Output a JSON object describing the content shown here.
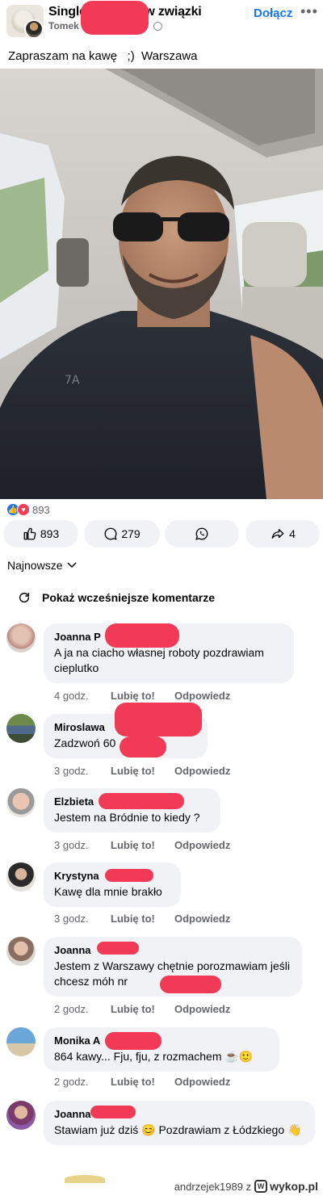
{
  "header": {
    "group_title": "Single łączy się w związki",
    "author": "Tomek",
    "join_label": "Dołącz",
    "more_label": "•••"
  },
  "post": {
    "text": "Zapraszam na kawę   ;)  Warszawa"
  },
  "reactions": {
    "count": "893"
  },
  "actions": {
    "like_count": "893",
    "comment_count": "279",
    "share_count": "4"
  },
  "sort": {
    "label": "Najnowsze"
  },
  "previous_comments_label": "Pokaż wcześniejsze komentarze",
  "comment_actions": {
    "like": "Lubię to!",
    "reply": "Odpowiedz"
  },
  "comments": [
    {
      "name": "Joanna P",
      "text": "A ja na ciacho własnej roboty pozdrawiam cieplutko",
      "time": "4 godz."
    },
    {
      "name": "Miroslawa",
      "text": "Zadzwoń 60",
      "time": "3 godz."
    },
    {
      "name": "Elzbieta",
      "text": "Jestem na Bródnie to kiedy ?",
      "time": "3 godz."
    },
    {
      "name": "Krystyna",
      "text": "Kawę dla mnie brakło",
      "time": "3 godz."
    },
    {
      "name": "Joanna",
      "text": "Jestem z Warszawy  chętnie porozmawiam jeśli chcesz móh nr",
      "time": "2 godz."
    },
    {
      "name": "Monika A",
      "text": "864 kawy... Fju, fju, z rozmachem ☕🙂",
      "time": "2 godz."
    },
    {
      "name": "Joanna",
      "text": "Stawiam już dziś 😊 Pozdrawiam z Łódzkiego 👋",
      "time": ""
    }
  ],
  "footer": {
    "credit": "andrzejek1989  z",
    "site": "wykop.pl"
  },
  "colors": {
    "accent": "#1877f2",
    "bubble": "#f0f2f5",
    "redaction": "#f23a56"
  }
}
